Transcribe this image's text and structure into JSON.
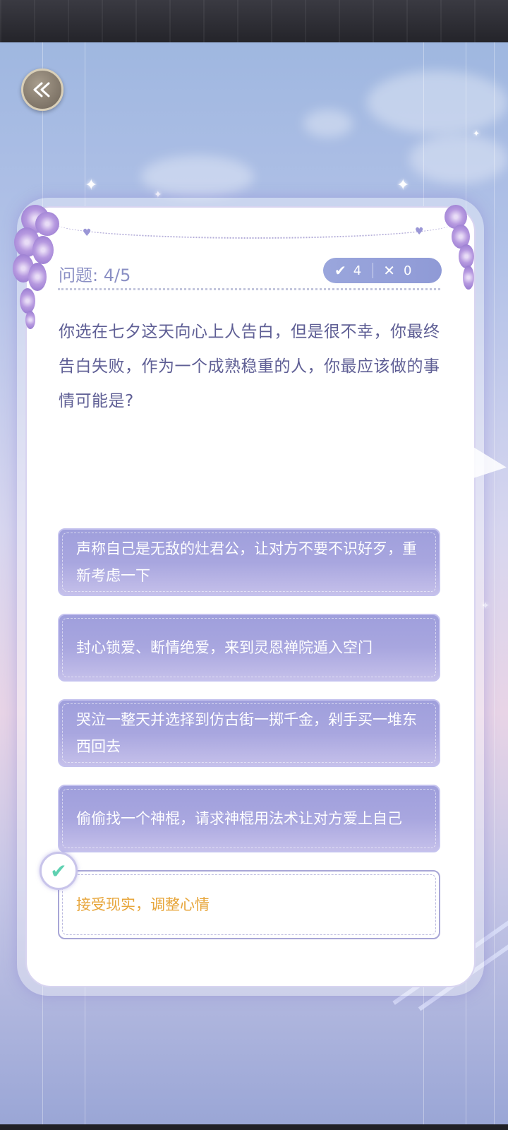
{
  "header": {
    "back_icon": "back-arrow-icon"
  },
  "quiz": {
    "question_label": "问题: 4/5",
    "score": {
      "correct_icon": "check-icon",
      "correct": "4",
      "wrong_icon": "close-icon",
      "wrong": "0"
    },
    "question": "你选在七夕这天向心上人告白，但是很不幸，你最终告白失败，作为一个成熟稳重的人，你最应该做的事情可能是?",
    "options": [
      {
        "text": "声称自己是无敌的灶君公，让对方不要不识好歹，重新考虑一下",
        "selected": false
      },
      {
        "text": "封心锁爱、断情绝爱，来到灵恩禅院遁入空门",
        "selected": false
      },
      {
        "text": "哭泣一整天并选择到仿古街一掷千金，剁手买一堆东西回去",
        "selected": false
      },
      {
        "text": "偷偷找一个神棍，请求神棍用法术让对方爱上自己",
        "selected": false
      },
      {
        "text": "接受现实，调整心情",
        "selected": true
      }
    ],
    "selected_icon": "check-icon"
  },
  "colors": {
    "option_fill": "#a8a6df",
    "selected_text": "#e7a53a",
    "question_text": "#5f5f95",
    "check": "#5fd1b1"
  }
}
